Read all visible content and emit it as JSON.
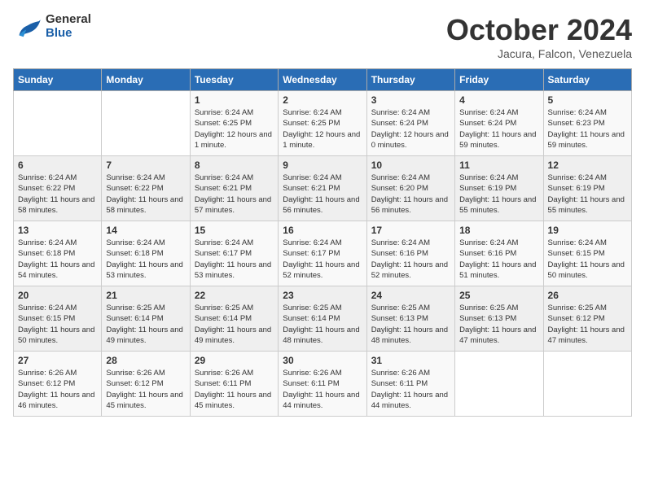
{
  "header": {
    "logo_general": "General",
    "logo_blue": "Blue",
    "month": "October 2024",
    "location": "Jacura, Falcon, Venezuela"
  },
  "days_of_week": [
    "Sunday",
    "Monday",
    "Tuesday",
    "Wednesday",
    "Thursday",
    "Friday",
    "Saturday"
  ],
  "weeks": [
    [
      {
        "day": "",
        "info": ""
      },
      {
        "day": "",
        "info": ""
      },
      {
        "day": "1",
        "info": "Sunrise: 6:24 AM\nSunset: 6:25 PM\nDaylight: 12 hours\nand 1 minute."
      },
      {
        "day": "2",
        "info": "Sunrise: 6:24 AM\nSunset: 6:25 PM\nDaylight: 12 hours\nand 1 minute."
      },
      {
        "day": "3",
        "info": "Sunrise: 6:24 AM\nSunset: 6:24 PM\nDaylight: 12 hours\nand 0 minutes."
      },
      {
        "day": "4",
        "info": "Sunrise: 6:24 AM\nSunset: 6:24 PM\nDaylight: 11 hours\nand 59 minutes."
      },
      {
        "day": "5",
        "info": "Sunrise: 6:24 AM\nSunset: 6:23 PM\nDaylight: 11 hours\nand 59 minutes."
      }
    ],
    [
      {
        "day": "6",
        "info": "Sunrise: 6:24 AM\nSunset: 6:22 PM\nDaylight: 11 hours\nand 58 minutes."
      },
      {
        "day": "7",
        "info": "Sunrise: 6:24 AM\nSunset: 6:22 PM\nDaylight: 11 hours\nand 58 minutes."
      },
      {
        "day": "8",
        "info": "Sunrise: 6:24 AM\nSunset: 6:21 PM\nDaylight: 11 hours\nand 57 minutes."
      },
      {
        "day": "9",
        "info": "Sunrise: 6:24 AM\nSunset: 6:21 PM\nDaylight: 11 hours\nand 56 minutes."
      },
      {
        "day": "10",
        "info": "Sunrise: 6:24 AM\nSunset: 6:20 PM\nDaylight: 11 hours\nand 56 minutes."
      },
      {
        "day": "11",
        "info": "Sunrise: 6:24 AM\nSunset: 6:19 PM\nDaylight: 11 hours\nand 55 minutes."
      },
      {
        "day": "12",
        "info": "Sunrise: 6:24 AM\nSunset: 6:19 PM\nDaylight: 11 hours\nand 55 minutes."
      }
    ],
    [
      {
        "day": "13",
        "info": "Sunrise: 6:24 AM\nSunset: 6:18 PM\nDaylight: 11 hours\nand 54 minutes."
      },
      {
        "day": "14",
        "info": "Sunrise: 6:24 AM\nSunset: 6:18 PM\nDaylight: 11 hours\nand 53 minutes."
      },
      {
        "day": "15",
        "info": "Sunrise: 6:24 AM\nSunset: 6:17 PM\nDaylight: 11 hours\nand 53 minutes."
      },
      {
        "day": "16",
        "info": "Sunrise: 6:24 AM\nSunset: 6:17 PM\nDaylight: 11 hours\nand 52 minutes."
      },
      {
        "day": "17",
        "info": "Sunrise: 6:24 AM\nSunset: 6:16 PM\nDaylight: 11 hours\nand 52 minutes."
      },
      {
        "day": "18",
        "info": "Sunrise: 6:24 AM\nSunset: 6:16 PM\nDaylight: 11 hours\nand 51 minutes."
      },
      {
        "day": "19",
        "info": "Sunrise: 6:24 AM\nSunset: 6:15 PM\nDaylight: 11 hours\nand 50 minutes."
      }
    ],
    [
      {
        "day": "20",
        "info": "Sunrise: 6:24 AM\nSunset: 6:15 PM\nDaylight: 11 hours\nand 50 minutes."
      },
      {
        "day": "21",
        "info": "Sunrise: 6:25 AM\nSunset: 6:14 PM\nDaylight: 11 hours\nand 49 minutes."
      },
      {
        "day": "22",
        "info": "Sunrise: 6:25 AM\nSunset: 6:14 PM\nDaylight: 11 hours\nand 49 minutes."
      },
      {
        "day": "23",
        "info": "Sunrise: 6:25 AM\nSunset: 6:14 PM\nDaylight: 11 hours\nand 48 minutes."
      },
      {
        "day": "24",
        "info": "Sunrise: 6:25 AM\nSunset: 6:13 PM\nDaylight: 11 hours\nand 48 minutes."
      },
      {
        "day": "25",
        "info": "Sunrise: 6:25 AM\nSunset: 6:13 PM\nDaylight: 11 hours\nand 47 minutes."
      },
      {
        "day": "26",
        "info": "Sunrise: 6:25 AM\nSunset: 6:12 PM\nDaylight: 11 hours\nand 47 minutes."
      }
    ],
    [
      {
        "day": "27",
        "info": "Sunrise: 6:26 AM\nSunset: 6:12 PM\nDaylight: 11 hours\nand 46 minutes."
      },
      {
        "day": "28",
        "info": "Sunrise: 6:26 AM\nSunset: 6:12 PM\nDaylight: 11 hours\nand 45 minutes."
      },
      {
        "day": "29",
        "info": "Sunrise: 6:26 AM\nSunset: 6:11 PM\nDaylight: 11 hours\nand 45 minutes."
      },
      {
        "day": "30",
        "info": "Sunrise: 6:26 AM\nSunset: 6:11 PM\nDaylight: 11 hours\nand 44 minutes."
      },
      {
        "day": "31",
        "info": "Sunrise: 6:26 AM\nSunset: 6:11 PM\nDaylight: 11 hours\nand 44 minutes."
      },
      {
        "day": "",
        "info": ""
      },
      {
        "day": "",
        "info": ""
      }
    ]
  ]
}
